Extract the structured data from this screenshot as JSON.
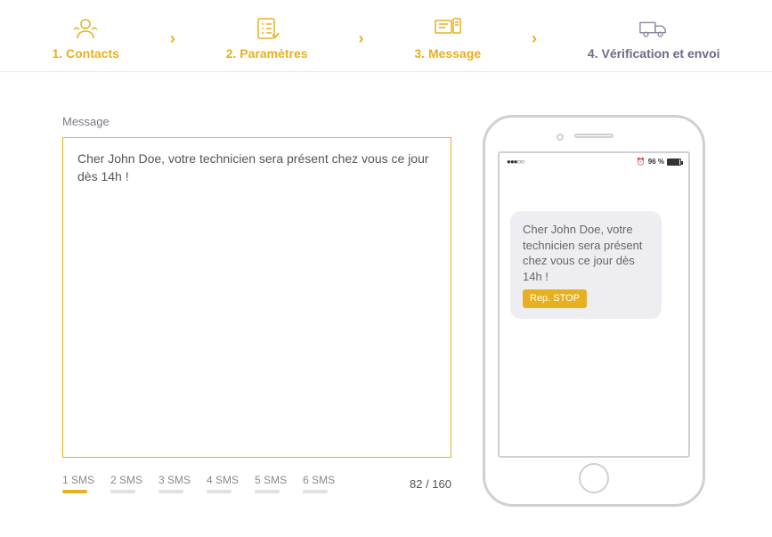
{
  "stepper": {
    "steps": [
      {
        "label": "1. Contacts",
        "state": "active"
      },
      {
        "label": "2. Paramètres",
        "state": "active"
      },
      {
        "label": "3. Message",
        "state": "active"
      },
      {
        "label": "4. Vérification et envoi",
        "state": "inactive"
      }
    ]
  },
  "message": {
    "label": "Message",
    "value": "Cher John Doe, votre technicien sera présent chez vous ce jour dès 14h !"
  },
  "sms_meter": {
    "items": [
      {
        "label": "1 SMS",
        "active": true
      },
      {
        "label": "2 SMS",
        "active": false
      },
      {
        "label": "3 SMS",
        "active": false
      },
      {
        "label": "4 SMS",
        "active": false
      },
      {
        "label": "5 SMS",
        "active": false
      },
      {
        "label": "6 SMS",
        "active": false
      }
    ],
    "count": "82 / 160"
  },
  "phone": {
    "signal": "●●●○○",
    "wifi": "⋮",
    "alarm": "⏰",
    "battery_pct": "96 %",
    "preview": "Cher John Doe, votre technicien sera présent chez vous ce jour dès 14h !",
    "stop": "Rep. STOP"
  }
}
